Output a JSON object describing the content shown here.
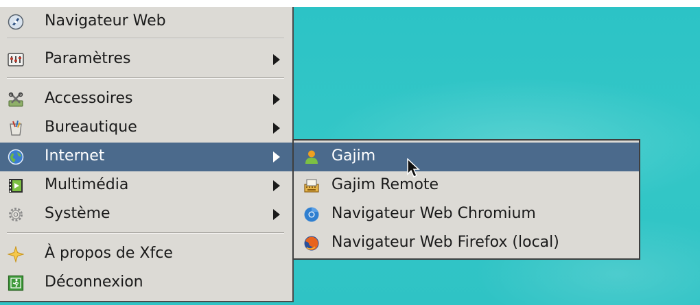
{
  "menu": {
    "items": [
      {
        "label": "Navigateur Web",
        "icon": "web-browser-icon",
        "has_submenu": false
      },
      {
        "label": "Paramètres",
        "icon": "settings-icon",
        "has_submenu": true
      },
      {
        "label": "Accessoires",
        "icon": "accessories-icon",
        "has_submenu": true
      },
      {
        "label": "Bureautique",
        "icon": "office-icon",
        "has_submenu": true
      },
      {
        "label": "Internet",
        "icon": "internet-globe-icon",
        "has_submenu": true,
        "active": true
      },
      {
        "label": "Multimédia",
        "icon": "multimedia-icon",
        "has_submenu": true
      },
      {
        "label": "Système",
        "icon": "system-gear-icon",
        "has_submenu": true
      },
      {
        "label": "À propos de Xfce",
        "icon": "about-star-icon",
        "has_submenu": false
      },
      {
        "label": "Déconnexion",
        "icon": "logout-icon",
        "has_submenu": false
      }
    ]
  },
  "submenu": {
    "parent": "Internet",
    "items": [
      {
        "label": "Gajim",
        "icon": "gajim-icon",
        "active": true
      },
      {
        "label": "Gajim Remote",
        "icon": "gajim-remote-icon"
      },
      {
        "label": "Navigateur Web Chromium",
        "icon": "chromium-icon"
      },
      {
        "label": "Navigateur Web Firefox (local)",
        "icon": "firefox-icon"
      }
    ]
  },
  "colors": {
    "menu_bg": "#dcdad5",
    "highlight": "#4b6a8c",
    "desktop": "#2ec4c5"
  }
}
